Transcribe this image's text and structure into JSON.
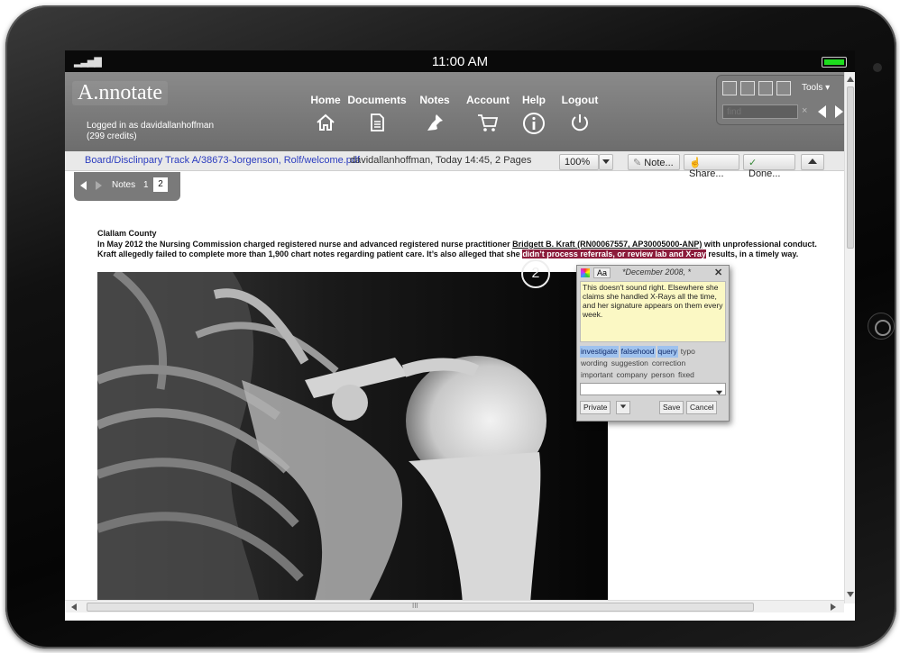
{
  "status_bar": {
    "signal": "▂▃▅▇",
    "time": "11:00 AM",
    "battery_level": 1.0
  },
  "header": {
    "logo": "A.nnotate",
    "login_line1": "Logged in as davidallanhoffman",
    "login_line2": "(299 credits)",
    "nav": [
      {
        "label": "Home",
        "icon": "home-icon"
      },
      {
        "label": "Documents",
        "icon": "document-icon"
      },
      {
        "label": "Notes",
        "icon": "pushpin-icon"
      },
      {
        "label": "Account",
        "icon": "shopping-cart-icon"
      },
      {
        "label": "Help",
        "icon": "info-icon"
      },
      {
        "label": "Logout",
        "icon": "power-icon"
      }
    ],
    "tools": {
      "label": "Tools ▾",
      "find_placeholder": "find",
      "clear": "×"
    }
  },
  "toolbar": {
    "breadcrumb": "Board/Disclinpary Track A/38673-Jorgenson, Rolf/welcome.pdf",
    "doc_info": "davidallanhoffman, Today 14:45, 2 Pages",
    "zoom": "100%",
    "note_label": "Note...",
    "share_label": "Share...",
    "done_label": "Done..."
  },
  "notes_panel": {
    "label": "Notes",
    "pages": [
      "1",
      "2"
    ],
    "current_page": "2"
  },
  "document": {
    "heading": "Clallam County",
    "body_before": "In May 2012 the Nursing Commission charged registered nurse and advanced registered nurse practitioner ",
    "body_name": "Bridgett B. Kraft (RN00067557, AP30005000-ANP)",
    "body_middle": " with unprofessional conduct. Kraft allegedly failed to complete more than 1,900 chart notes regarding patient care. It’s also alleged that she ",
    "body_highlight": "didn’t process referrals, or review lab and X-ray",
    "body_after": " results, in a timely way.",
    "marker_label": "2"
  },
  "note_popup": {
    "font_button": "Aa",
    "date": "*December 2008, *",
    "close": "✕",
    "text": "This doesn't sound right. Elsewhere she claims she handled X-Rays all the time, and her signature appears on them every week.",
    "tags": [
      {
        "label": "investigate",
        "selected": true
      },
      {
        "label": "falsehood",
        "selected": true
      },
      {
        "label": "query",
        "selected": true
      },
      {
        "label": "typo",
        "selected": false
      },
      {
        "label": "wording",
        "selected": false
      },
      {
        "label": "suggestion",
        "selected": false
      },
      {
        "label": "correction",
        "selected": false
      },
      {
        "label": "important",
        "selected": false
      },
      {
        "label": "company",
        "selected": false
      },
      {
        "label": "person",
        "selected": false
      },
      {
        "label": "fixed",
        "selected": false
      }
    ],
    "visibility": "Private",
    "save": "Save",
    "cancel": "Cancel"
  },
  "scrollbar": {
    "hscroll_grip": "III"
  }
}
